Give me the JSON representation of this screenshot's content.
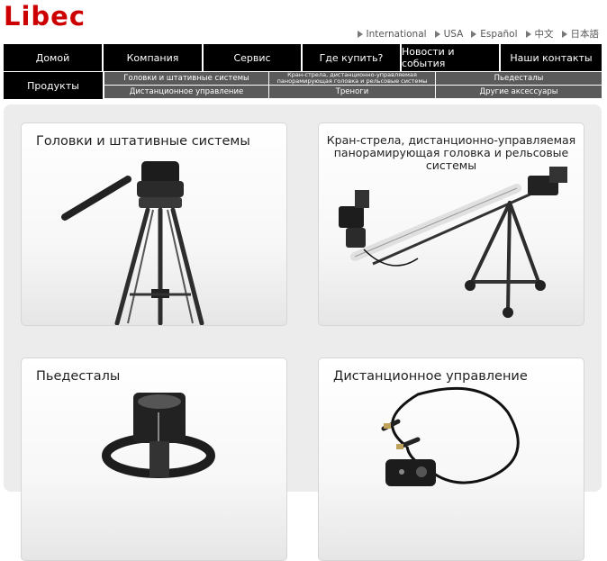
{
  "brand": {
    "logo": "Libec",
    "color": "#cc0000"
  },
  "languages": [
    {
      "label": "International"
    },
    {
      "label": "USA"
    },
    {
      "label": "Español"
    },
    {
      "label": "中文"
    },
    {
      "label": "日本語"
    }
  ],
  "nav": {
    "items": [
      {
        "label": "Домой"
      },
      {
        "label": "Компания"
      },
      {
        "label": "Сервис"
      },
      {
        "label": "Где купить?"
      },
      {
        "label": "Новости и события"
      },
      {
        "label": "Наши контакты"
      }
    ],
    "products_label": "Продукты"
  },
  "subnav": [
    {
      "label": "Головки и штативные системы"
    },
    {
      "label": "Кран-стрела, дистанционно-управляемая панорамирующая головка и рельсовые системы"
    },
    {
      "label": "Пьедесталы"
    },
    {
      "label": "Дистанционное управление"
    },
    {
      "label": "Треноги"
    },
    {
      "label": "Другие аксессуары"
    }
  ],
  "cards": [
    {
      "title": "Головки и штативные системы",
      "icon": "tripod-head-image"
    },
    {
      "title": "Кран-стрела, дистанционно-управляемая панорамирующая головка и рельсовые системы",
      "icon": "crane-jib-image"
    },
    {
      "title": "Пьедесталы",
      "icon": "pedestal-image"
    },
    {
      "title": "Дистанционное управление",
      "icon": "remote-control-image"
    }
  ]
}
